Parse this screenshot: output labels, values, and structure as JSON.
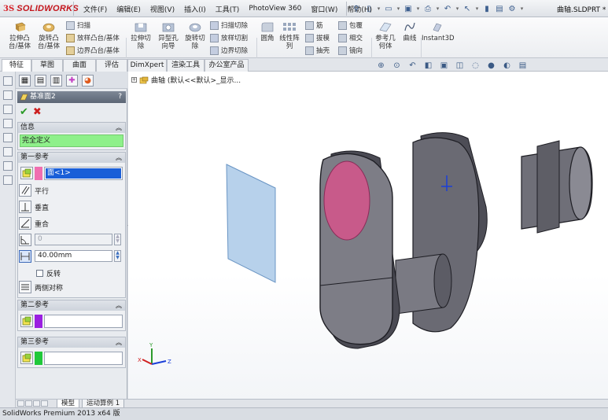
{
  "app": {
    "brand_ds": "3S",
    "brand_name": "SOLIDWORKS",
    "document_title": "曲轴.SLDPRT *"
  },
  "menu": [
    "文件(F)",
    "编辑(E)",
    "视图(V)",
    "插入(I)",
    "工具(T)",
    "PhotoView 360",
    "窗口(W)",
    "帮助(H)"
  ],
  "commands": {
    "extrude_boss": "拉伸凸\n台/基体",
    "revolve_boss": "旋转凸\n台/基体",
    "sweep": "扫描",
    "loft_boss": "放样凸台/基体",
    "boundary_boss": "边界凸台/基体",
    "extrude_cut": "拉伸切\n除",
    "hole_wizard": "异型孔\n向导",
    "revolve_cut": "旋转切\n除",
    "swept_cut": "扫描切除",
    "lofted_cut": "放样切割",
    "boundary_cut": "边界切除",
    "fillet": "圆角",
    "linear_pattern": "线性阵\n列",
    "rib": "筋",
    "draft": "拔模",
    "shell": "抽壳",
    "wrap": "包覆",
    "intersect": "相交",
    "mirror": "镜向",
    "ref_geometry": "参考几\n何体",
    "curves": "曲线",
    "instant3d": "Instant3D"
  },
  "tabs": [
    "特征",
    "草图",
    "曲面",
    "评估",
    "DimXpert",
    "渲染工具",
    "办公室产品"
  ],
  "feature_tree": {
    "root_label": "曲轴  (默认<<默认>_显示..."
  },
  "property_manager": {
    "title": "基准面2",
    "help": "?",
    "info_header": "信息",
    "status": "完全定义",
    "first_ref": {
      "header": "第一参考",
      "selection": "面<1>",
      "options": [
        "平行",
        "垂直",
        "重合"
      ],
      "angle_value": "0",
      "distance_value": "40.00mm",
      "flip_label": "反转",
      "mid_plane_label": "两侧对称"
    },
    "second_ref": {
      "header": "第二参考",
      "selection": ""
    },
    "third_ref": {
      "header": "第三参考",
      "selection": ""
    }
  },
  "bottom_tabs": [
    "模型",
    "运动算例 1"
  ],
  "status_bar": "SolidWorks Premium 2013 x64 版",
  "triad": {
    "x": "X",
    "y": "Y",
    "z": "Z"
  },
  "colors": {
    "accent_face": "#c85a8a",
    "first_ref_swatch": "#f06eb0",
    "second_ref_swatch": "#9a1fe0",
    "third_ref_swatch": "#20c83a",
    "status_green": "#8ef08a",
    "plane_fill": "#9fc1e4"
  }
}
